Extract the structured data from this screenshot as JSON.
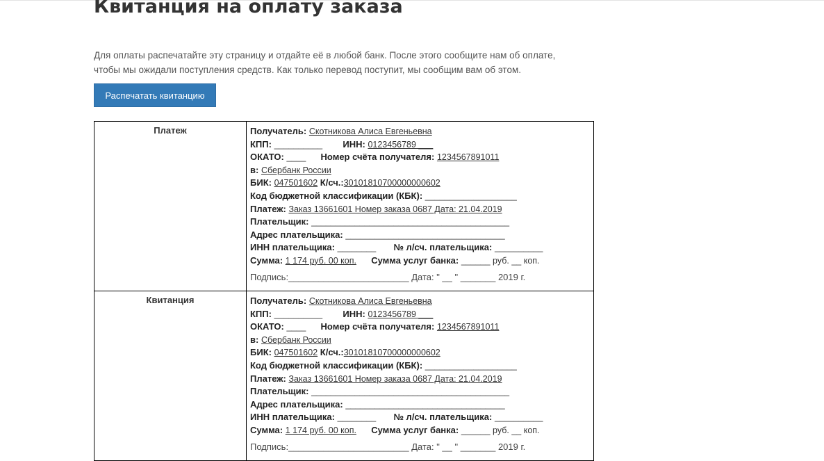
{
  "page": {
    "title": "Квитанция на оплату заказа",
    "intro_line1": "Для оплаты распечатайте эту страницу и отдайте её в любой банк. После этого сообщите нам об оплате,",
    "intro_line2": "чтобы мы ожидали поступления средств. Как только перевод поступит, мы сообщим вам об этом.",
    "print_button": "Распечатать квитанцию"
  },
  "sections": [
    {
      "label": "Платеж",
      "recipient_label": "Получатель:",
      "recipient": "Скотникова Алиса Евгеньевна",
      "kpp_label": "КПП:",
      "kpp": "__________",
      "inn_label": "ИНН:",
      "inn": "0123456789 ___",
      "okato_label": "ОКАТО:",
      "okato": "____",
      "account_label": "Номер счёта получателя:",
      "account": "1234567891011",
      "bank_label": "в:",
      "bank": "Сбербанк России",
      "bik_label": "БИК:",
      "bik": "047501602",
      "ks_label": "К/сч.:",
      "ks": "30101810700000000602",
      "kbk_label": "Код бюджетной классификации (КБК):",
      "kbk": "___________________",
      "payment_label": "Платеж:",
      "payment": "Заказ 13661601 Номер заказа 0687 Дата: 21.04.2019",
      "payer_label": "Плательщик:",
      "payer": "_________________________________________",
      "payer_address_label": "Адрес плательщика:",
      "payer_address": "_________________________________",
      "payer_inn_label": "ИНН плательщика:",
      "payer_inn": "________",
      "payer_account_label": "№ л/сч. плательщика:",
      "payer_account": "__________",
      "sum_label": "Сумма:",
      "sum": "1 174 руб.  00 коп.",
      "bank_fee_label": "Сумма услуг банка:",
      "bank_fee": "______ руб. __ коп.",
      "signature": "Подпись:________________________ Дата: \" __ \" _______  2019 г."
    },
    {
      "label": "Квитанция",
      "recipient_label": "Получатель:",
      "recipient": "Скотникова Алиса Евгеньевна",
      "kpp_label": "КПП:",
      "kpp": "__________",
      "inn_label": "ИНН:",
      "inn": "0123456789 ___",
      "okato_label": "ОКАТО:",
      "okato": "____",
      "account_label": "Номер счёта получателя:",
      "account": "1234567891011",
      "bank_label": "в:",
      "bank": "Сбербанк России",
      "bik_label": "БИК:",
      "bik": "047501602",
      "ks_label": "К/сч.:",
      "ks": "30101810700000000602",
      "kbk_label": "Код бюджетной классификации (КБК):",
      "kbk": "___________________",
      "payment_label": "Платеж:",
      "payment": "Заказ 13661601 Номер заказа 0687 Дата: 21.04.2019",
      "payer_label": "Плательщик:",
      "payer": "_________________________________________",
      "payer_address_label": "Адрес плательщика:",
      "payer_address": "_________________________________",
      "payer_inn_label": "ИНН плательщика:",
      "payer_inn": "________",
      "payer_account_label": "№ л/сч. плательщика:",
      "payer_account": "__________",
      "sum_label": "Сумма:",
      "sum": "1 174 руб.  00 коп.",
      "bank_fee_label": "Сумма услуг банка:",
      "bank_fee": "______ руб. __ коп.",
      "signature": "Подпись:________________________ Дата: \" __ \" _______  2019 г."
    }
  ]
}
